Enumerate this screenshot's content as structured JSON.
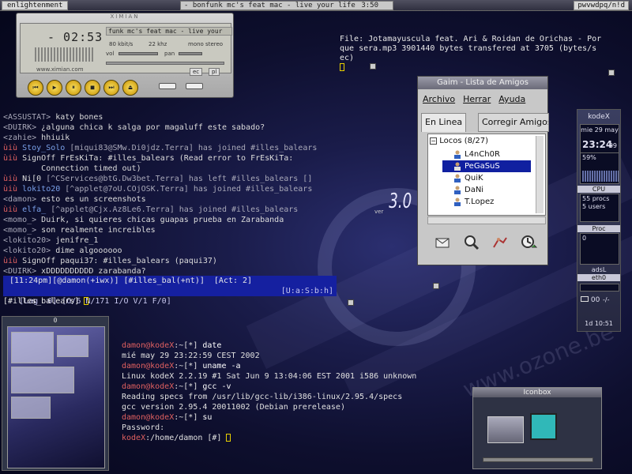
{
  "topbar": {
    "left_label": "enlightenment",
    "center_label": "- bonfunk mc's feat mac - live your life",
    "center_time": "3:50",
    "right_label": "pwvwdpq/n!d"
  },
  "xmms": {
    "brand": "XIMIAN",
    "time": "- 02:53",
    "song_title": "funk mc's feat mac - live your",
    "kbps": "80 kbit/s",
    "khz": "22 khz",
    "mono_stereo": "mono stereo",
    "vol_label": "vol",
    "pan_label": "pan",
    "eq_label": "ec",
    "pl_label": "pl",
    "url": "www.ximian.com",
    "buttons": [
      "prev",
      "play",
      "pause",
      "stop",
      "next",
      "eject"
    ]
  },
  "transfer": {
    "line1": "File: Jotamayuscula feat. Ari & Roidan de Orichas - Por",
    "line2": "que sera.mp3  3901440 bytes transfered at 3705 (bytes/s",
    "line3": "ec)"
  },
  "irc": {
    "lines": [
      {
        "a": "<ASSUSTAT> ",
        "b": "katy bones",
        "c": ""
      },
      {
        "a": "<DUIRK> ",
        "b": "¿alguna chica k salga por magaluff este sabado?",
        "c": ""
      },
      {
        "a": "<zahie> ",
        "b": "hhiuik",
        "c": ""
      },
      {
        "a": "ùiù ",
        "b": "Stoy_Solo ",
        "c": "[miqui83@SMw.Di0jdz.Terra] has joined #illes_balears"
      },
      {
        "a": "ùiù ",
        "b": "SignOff FrEsKiTa: #illes_balears (Read error to FrEsKiTa:",
        "c": ""
      },
      {
        "a": "        ",
        "b": "Connection timed out)",
        "c": ""
      },
      {
        "a": "ùiù ",
        "b": "Ni[0 ",
        "c": "[^CServices@btG.Dw3bet.Terra] has left #illes_balears []"
      },
      {
        "a": "ùiù ",
        "b": "lokito20 ",
        "c": "[^applet@7oU.COjOSK.Terra] has joined #illes_balears"
      },
      {
        "a": "<damon> ",
        "b": "esto es un screenshots",
        "c": ""
      },
      {
        "a": "ùiù ",
        "b": "elfa_ ",
        "c": "[^applet@Cjx.Az8Le6.Terra] has joined #illes_balears"
      },
      {
        "a": "<momo_> ",
        "b": "Duirk, si quieres chicas guapas prueba en Zarabanda",
        "c": ""
      },
      {
        "a": "<momo_> ",
        "b": "son realmente increibles",
        "c": ""
      },
      {
        "a": "<lokito20> ",
        "b": "jenifre_1",
        "c": ""
      },
      {
        "a": "<lokito20> ",
        "b": "dime algoooooo",
        "c": ""
      },
      {
        "a": "ùiù ",
        "b": "SignOff paqui37: #illes_balears (paqui37)",
        "c": ""
      },
      {
        "a": "<DUIRK> ",
        "b": "xDDDDDDDDDD zarabanda?",
        "c": ""
      }
    ],
    "status1": " [11:24pm][@damon(+iwx)] [#illes_bal(+nt)]  [Act: 2]",
    "status2": " [Lag  0] [O/6 N/171 I/O V/1 F/0]",
    "status2_right": "[U:a:S:b:h]",
    "input": "[#illes_balears] "
  },
  "gaim": {
    "title": "Gaim - Lista de Amigos",
    "menu": [
      "Archivo",
      "Herrar",
      "Ayuda"
    ],
    "tabs": [
      "En Linea",
      "Corregir Amigos"
    ],
    "group": "Locos (8/27)",
    "buddies": [
      "L4nCh0R",
      "PeGaSuS",
      "QuiK",
      "DaNi",
      "T.Lopez"
    ],
    "selected_index": 1
  },
  "gkrellm": {
    "host": "kodeX",
    "date": "mie 29 may",
    "time": "23:24",
    "seconds": "09",
    "cpu_pct": "59%",
    "cpu_label": "CPU",
    "procs": "55 procs",
    "users": "5 users",
    "proc_label": "Proc",
    "zero": "0",
    "net_label": "adsL",
    "net_if": "eth0",
    "mail": "00",
    "mail_sep": "-/-",
    "uptime": "1d 10:51"
  },
  "pager": {
    "title": "0"
  },
  "terminal": {
    "lines": [
      {
        "p": "damon@kodeX",
        "q": ":~[*] ",
        "r": "date"
      },
      {
        "p": "",
        "q": "",
        "r": "mié may 29 23:22:59 CEST 2002"
      },
      {
        "p": "damon@kodeX",
        "q": ":~[*] ",
        "r": "uname -a"
      },
      {
        "p": "",
        "q": "",
        "r": "Linux kodeX 2.2.19 #1 Sat Jun 9 13:04:06 EST 2001 i586 unknown"
      },
      {
        "p": "damon@kodeX",
        "q": ":~[*] ",
        "r": "gcc -v"
      },
      {
        "p": "",
        "q": "",
        "r": "Reading specs from /usr/lib/gcc-lib/i386-linux/2.95.4/specs"
      },
      {
        "p": "",
        "q": "",
        "r": "gcc version 2.95.4 20011002 (Debian prerelease)"
      },
      {
        "p": "damon@kodeX",
        "q": ":~[*] ",
        "r": "su"
      },
      {
        "p": "",
        "q": "",
        "r": "Password:"
      },
      {
        "p": "kodeX",
        "q": ":/home/damon [#] ",
        "r": ""
      }
    ]
  },
  "iconbox": {
    "title": "Iconbox"
  },
  "desktop": {
    "version": "3.0",
    "version_prefix": "ver",
    "watermark": "www.ozone.be"
  },
  "colors": {
    "irc_status_bg": "#1520a0",
    "prompt_red": "#e06060",
    "cursor_yellow": "#e8d000",
    "gaim_selection": "#1020a0"
  }
}
